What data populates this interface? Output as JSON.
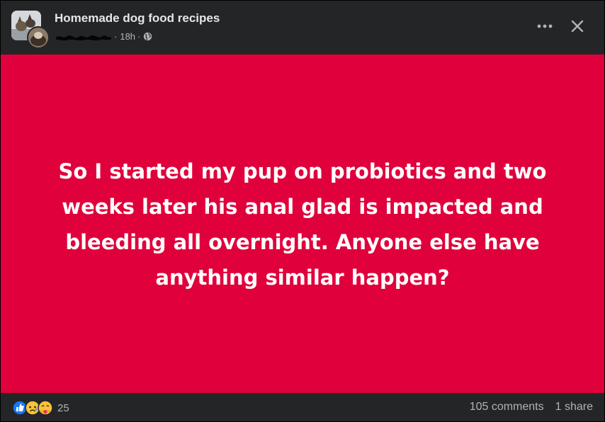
{
  "post": {
    "group_name": "Homemade dog food recipes",
    "time": "18h",
    "separator": "·",
    "text": "So I started my pup on probiotics and two weeks later his anal glad is impacted and bleeding all overnight. Anyone else have anything similar happen?",
    "background_color": "#e0003b"
  },
  "header": {
    "more_icon": "more-dots-icon",
    "close_icon": "close-icon",
    "privacy_icon": "globe-icon"
  },
  "footer": {
    "reactions": [
      "like",
      "sad",
      "care"
    ],
    "reaction_count": "25",
    "comments": "105 comments",
    "shares": "1 share"
  }
}
